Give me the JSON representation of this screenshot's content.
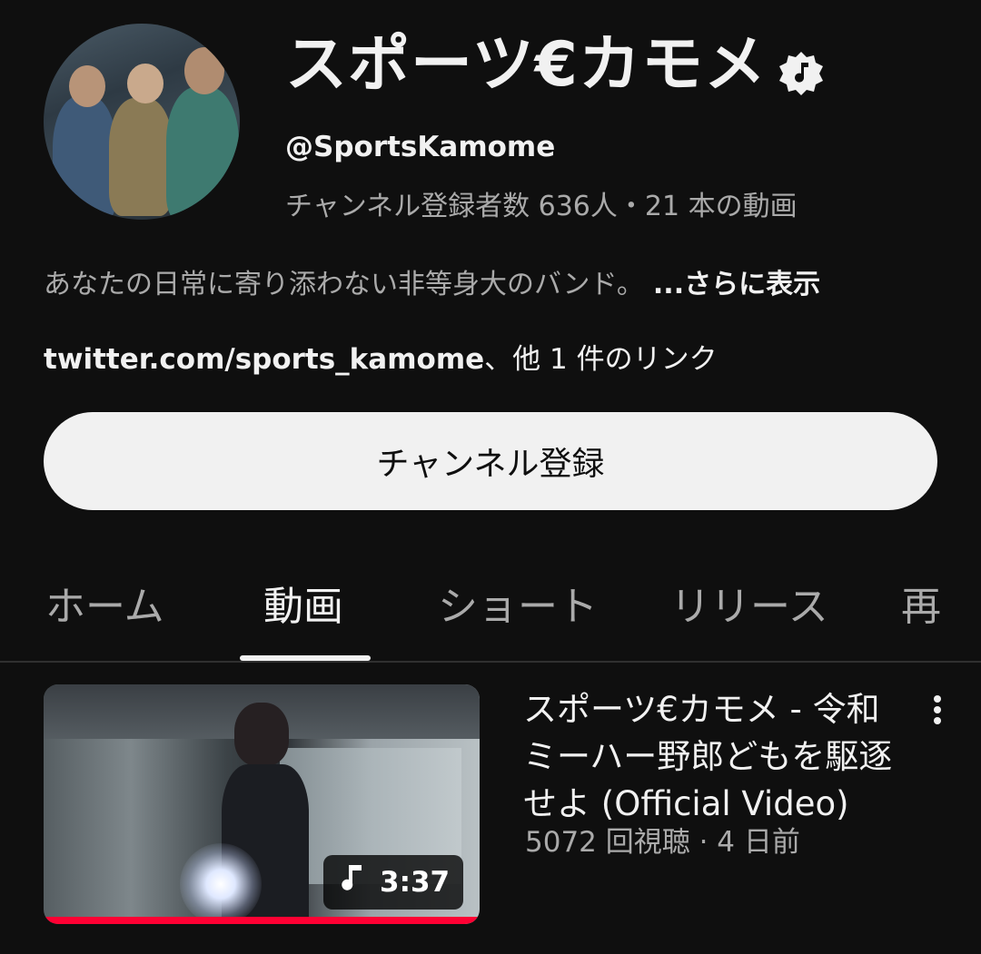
{
  "channel": {
    "name": "スポーツ€カモメ",
    "verified_icon": "music-note-verified-icon",
    "handle": "@SportsKamome",
    "stats": "チャンネル登録者数 636人・21 本の動画",
    "description": "あなたの日常に寄り添わない非等身大のバンド。",
    "more_label": "...さらに表示",
    "link_url": "twitter.com/sports_kamome",
    "link_suffix": "、他 1 件のリンク",
    "subscribe_label": "チャンネル登録"
  },
  "tabs": [
    {
      "label": "ホーム",
      "active": false
    },
    {
      "label": "動画",
      "active": true
    },
    {
      "label": "ショート",
      "active": false
    },
    {
      "label": "リリース",
      "active": false
    },
    {
      "label": "再",
      "active": false
    }
  ],
  "videos": [
    {
      "title": "スポーツ€カモメ - 令和ミーハー野郎どもを駆逐せよ (Official Video)",
      "meta": "5072 回視聴 · 4 日前",
      "duration": "3:37",
      "duration_icon": "music-note-icon",
      "watched_progress": 1.0
    }
  ],
  "colors": {
    "background": "#0f0f0f",
    "text": "#f1f1f1",
    "secondary_text": "#aaaaaa",
    "progress": "#ff0033"
  }
}
